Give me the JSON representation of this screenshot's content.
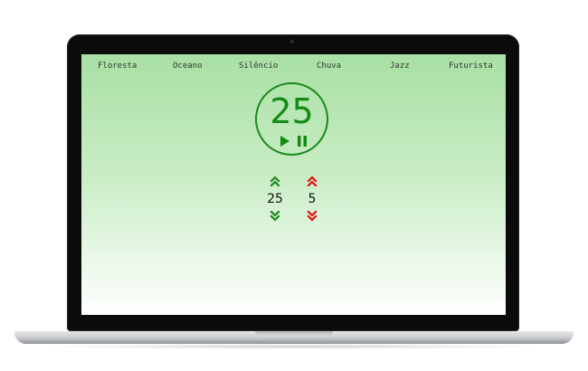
{
  "nav": {
    "items": [
      {
        "label": "Floresta"
      },
      {
        "label": "Oceano"
      },
      {
        "label": "Silêncio"
      },
      {
        "label": "Chuva"
      },
      {
        "label": "Jazz"
      },
      {
        "label": "Futurista"
      }
    ]
  },
  "timer": {
    "value": "25",
    "play_icon": "play-icon",
    "pause_icon": "pause-icon"
  },
  "session": {
    "value": "25",
    "increase_icon": "double-chevron-up-icon",
    "decrease_icon": "double-chevron-down-icon",
    "color": "#1a8a1a"
  },
  "break": {
    "value": "5",
    "increase_icon": "double-chevron-up-icon",
    "decrease_icon": "double-chevron-down-icon",
    "color": "#dd1111"
  },
  "colors": {
    "accent": "#138c13",
    "screen_top": "#a8e0a4",
    "screen_bottom": "#ffffff"
  }
}
